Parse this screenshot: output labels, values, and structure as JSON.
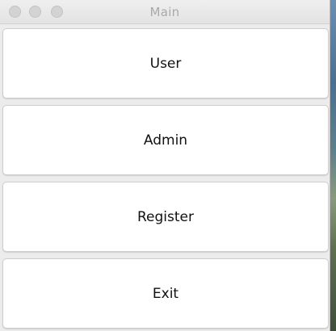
{
  "window": {
    "title": "Main"
  },
  "buttons": {
    "user": "User",
    "admin": "Admin",
    "register": "Register",
    "exit": "Exit"
  },
  "colors": {
    "window_background": "#ececec",
    "button_background": "#ffffff",
    "title_text": "#a9a9a9",
    "traffic_light_inactive": "#d3d3d3"
  }
}
